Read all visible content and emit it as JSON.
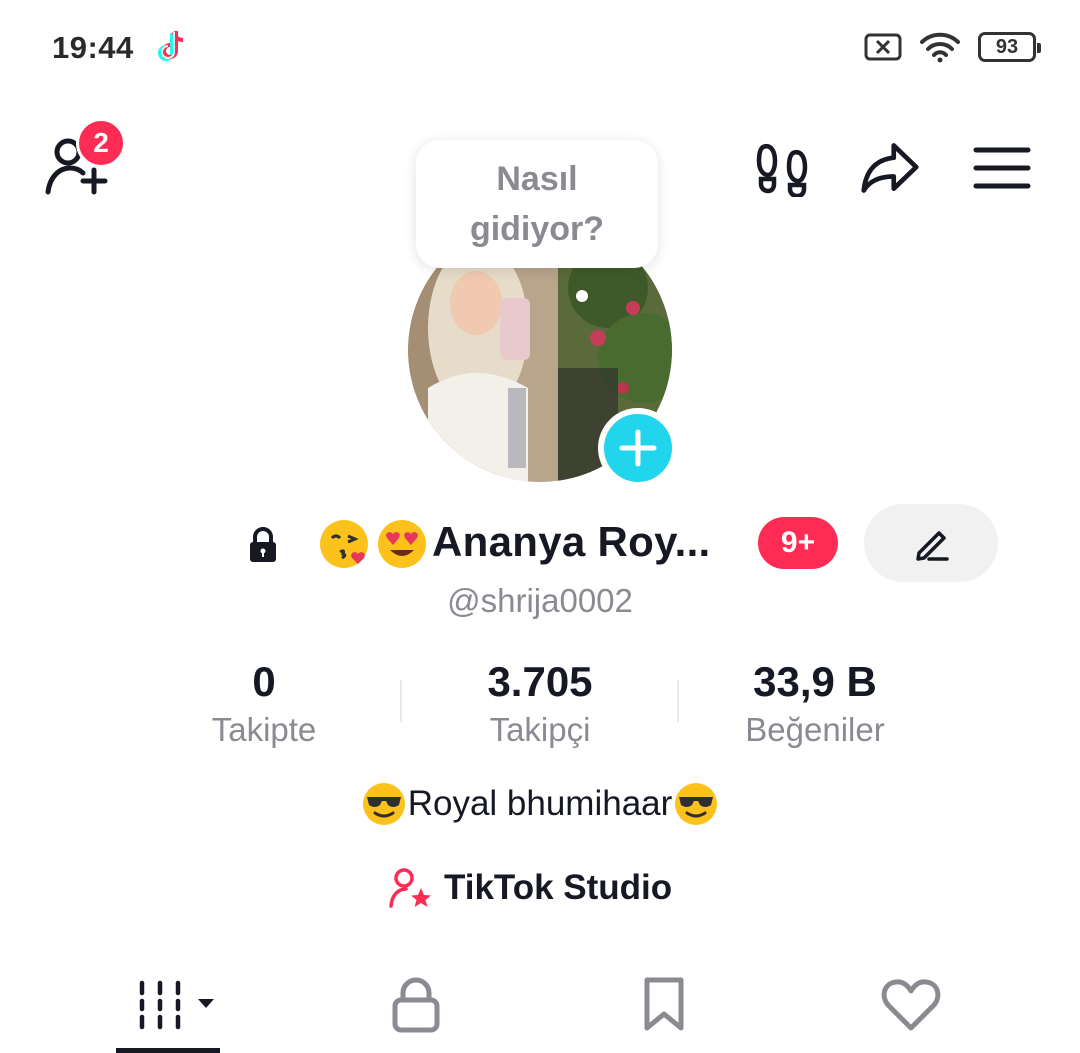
{
  "status_bar": {
    "time": "19:44",
    "app_icon": "tiktok-note-icon",
    "battery_level": "93",
    "icons": [
      "sim-x-icon",
      "wifi-icon",
      "battery-icon"
    ]
  },
  "header": {
    "add_friend_icon": "add-friend-icon",
    "friend_requests_count": "2",
    "actions": [
      "footprints-icon",
      "share-icon",
      "menu-icon"
    ]
  },
  "profile": {
    "bubble_text": "Nasıl gidiyor?",
    "display_name": "Ananya Roy...",
    "name_emojis": [
      "kissing-face-emoji",
      "heart-eyes-emoji"
    ],
    "notification_badge": "9+",
    "username": "@shrija0002",
    "stats": [
      {
        "value": "0",
        "label": "Takipte"
      },
      {
        "value": "3.705",
        "label": "Takipçi"
      },
      {
        "value": "33,9 B",
        "label": "Beğeniler"
      }
    ],
    "bio": "Royal bhumihaar",
    "studio_label": "TikTok Studio"
  },
  "tabs": [
    "videos-grid-icon",
    "private-lock-icon",
    "favorites-bookmark-icon",
    "liked-heart-icon"
  ],
  "colors": {
    "accent_red": "#fe2c55",
    "accent_cyan": "#20d5ec",
    "text_primary": "#161823",
    "text_secondary": "#8a8b91"
  }
}
